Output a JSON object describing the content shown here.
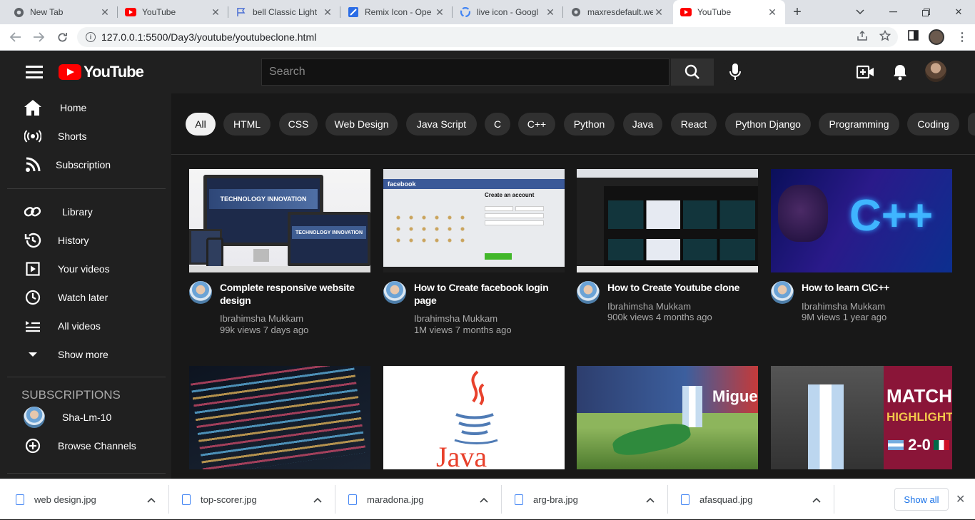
{
  "browser": {
    "tabs": [
      {
        "title": "New Tab",
        "icon": "chrome-icon"
      },
      {
        "title": "YouTube",
        "icon": "youtube-icon"
      },
      {
        "title": "bell Classic Light",
        "icon": "flag-icon"
      },
      {
        "title": "Remix Icon - Ope",
        "icon": "remix-icon"
      },
      {
        "title": "live icon - Googl",
        "icon": "google-icon"
      },
      {
        "title": "maxresdefault.we",
        "icon": "globe-icon"
      },
      {
        "title": "YouTube",
        "icon": "youtube-icon",
        "active": true
      }
    ],
    "url": "127.0.0.1:5500/Day3/youtube/youtubeclone.html"
  },
  "header": {
    "logo_text": "YouTube",
    "search_placeholder": "Search"
  },
  "sidebar": {
    "main": [
      {
        "label": "Home",
        "icon": "home-icon"
      },
      {
        "label": "Shorts",
        "icon": "shorts-icon"
      },
      {
        "label": "Subscription",
        "icon": "subscription-icon"
      }
    ],
    "library": [
      {
        "label": "Library",
        "icon": "library-icon"
      },
      {
        "label": "History",
        "icon": "history-icon"
      },
      {
        "label": "Your videos",
        "icon": "your-videos-icon"
      },
      {
        "label": "Watch later",
        "icon": "watch-later-icon"
      },
      {
        "label": "All videos",
        "icon": "all-videos-icon"
      },
      {
        "label": "Show more",
        "icon": "chevron-down-icon"
      }
    ],
    "subscriptions_heading": "SUBSCRIPTIONS",
    "channels": [
      {
        "label": "Sha-Lm-10"
      },
      {
        "label": "Browse Channels",
        "icon": "add-circle-icon"
      }
    ]
  },
  "chips": [
    "All",
    "HTML",
    "CSS",
    "Web Design",
    "Java Script",
    "C",
    "C++",
    "Python",
    "Java",
    "React",
    "Python Django",
    "Programming",
    "Coding"
  ],
  "videos": [
    {
      "title": "Complete responsive website design",
      "channel": "Ibrahimsha Mukkam",
      "meta": "99k views  7 days ago"
    },
    {
      "title": "How to Create facebook login page",
      "channel": "Ibrahimsha Mukkam",
      "meta": "1M views  7 months ago"
    },
    {
      "title": "How to Create Youtube clone",
      "channel": "Ibrahimsha Mukkam",
      "meta": "900k views  4 months ago"
    },
    {
      "title": "How to learn C\\C++",
      "channel": "Ibrahimsha Mukkam",
      "meta": "9M views  1 year ago"
    }
  ],
  "thumbs": {
    "t1_text": "TECHNOLOGY INNOVATION",
    "t2_brand": "facebook",
    "t2_heading": "Create an account",
    "t4_text": "C++",
    "t6_text": "Java",
    "t7_text": "Miguel",
    "t8_line1": "MATCH",
    "t8_line2": "HIGHLIGHTS",
    "t8_score": "2-0"
  },
  "downloads": {
    "files": [
      "web design.jpg",
      "top-scorer.jpg",
      "maradona.jpg",
      "arg-bra.jpg",
      "afasquad.jpg"
    ],
    "show_all": "Show all"
  }
}
